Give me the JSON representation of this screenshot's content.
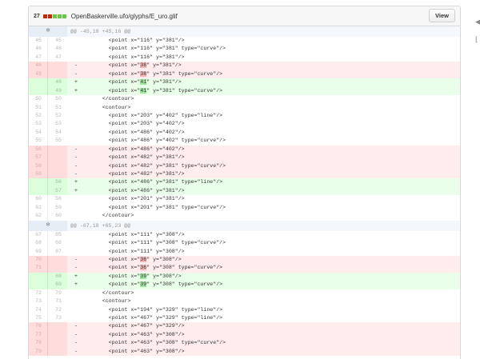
{
  "file": {
    "count": "27",
    "path": "OpenBaskerville.ufo/glyphs/E_uro.glif",
    "view_label": "View",
    "stat_colors": [
      "#bd2c00",
      "#bd2c00",
      "#6cc644",
      "#6cc644",
      "#6cc644"
    ]
  },
  "rows": [
    {
      "type": "hunk",
      "text": "@@ -45,18 +45,16 @@"
    },
    {
      "type": "ctx",
      "l": "45",
      "r": "45",
      "pre": "        <point x=\"116\" y=\"381\"/>"
    },
    {
      "type": "ctx",
      "l": "46",
      "r": "46",
      "pre": "        <point x=\"116\" y=\"381\" type=\"curve\"/>"
    },
    {
      "type": "ctx",
      "l": "47",
      "r": "47",
      "pre": "        <point x=\"116\" y=\"381\"/>"
    },
    {
      "type": "del",
      "l": "48",
      "r": "",
      "sign": "-",
      "pre": "        <point x=\"",
      "hl": "38",
      "post": "\" y=\"381\"/>"
    },
    {
      "type": "del",
      "l": "49",
      "r": "",
      "sign": "-",
      "pre": "        <point x=\"",
      "hl": "38",
      "post": "\" y=\"381\" type=\"curve\"/>"
    },
    {
      "type": "add",
      "l": "",
      "r": "48",
      "sign": "+",
      "pre": "        <point x=\"",
      "hl": "41",
      "post": "\" y=\"381\"/>"
    },
    {
      "type": "add",
      "l": "",
      "r": "49",
      "sign": "+",
      "pre": "        <point x=\"",
      "hl": "41",
      "post": "\" y=\"381\" type=\"curve\"/>"
    },
    {
      "type": "ctx",
      "l": "50",
      "r": "50",
      "pre": "      </contour>"
    },
    {
      "type": "ctx",
      "l": "51",
      "r": "51",
      "pre": "      <contour>"
    },
    {
      "type": "ctx",
      "l": "52",
      "r": "52",
      "pre": "        <point x=\"203\" y=\"402\" type=\"line\"/>"
    },
    {
      "type": "ctx",
      "l": "53",
      "r": "53",
      "pre": "        <point x=\"203\" y=\"402\"/>"
    },
    {
      "type": "ctx",
      "l": "54",
      "r": "54",
      "pre": "        <point x=\"486\" y=\"402\"/>"
    },
    {
      "type": "ctx",
      "l": "55",
      "r": "55",
      "pre": "        <point x=\"486\" y=\"402\" type=\"curve\"/>"
    },
    {
      "type": "del",
      "l": "56",
      "r": "",
      "sign": "-",
      "pre": "        <point x=\"486\" y=\"402\"/>"
    },
    {
      "type": "del",
      "l": "57",
      "r": "",
      "sign": "-",
      "pre": "        <point x=\"482\" y=\"381\"/>"
    },
    {
      "type": "del",
      "l": "58",
      "r": "",
      "sign": "-",
      "pre": "        <point x=\"482\" y=\"381\" type=\"curve\"/>"
    },
    {
      "type": "del",
      "l": "59",
      "r": "",
      "sign": "-",
      "pre": "        <point x=\"482\" y=\"381\"/>"
    },
    {
      "type": "add",
      "l": "",
      "r": "56",
      "sign": "+",
      "pre": "        <point x=\"486\" y=\"381\" type=\"line\"/>"
    },
    {
      "type": "add",
      "l": "",
      "r": "57",
      "sign": "+",
      "pre": "        <point x=\"486\" y=\"381\"/>"
    },
    {
      "type": "ctx",
      "l": "60",
      "r": "58",
      "pre": "        <point x=\"201\" y=\"381\"/>"
    },
    {
      "type": "ctx",
      "l": "61",
      "r": "59",
      "pre": "        <point x=\"201\" y=\"381\" type=\"curve\"/>"
    },
    {
      "type": "ctx",
      "l": "62",
      "r": "60",
      "pre": "      </contour>"
    },
    {
      "type": "hunk",
      "text": "@@ -67,18 +65,23 @@"
    },
    {
      "type": "ctx",
      "l": "67",
      "r": "65",
      "pre": "        <point x=\"111\" y=\"308\"/>"
    },
    {
      "type": "ctx",
      "l": "68",
      "r": "66",
      "pre": "        <point x=\"111\" y=\"308\" type=\"curve\"/>"
    },
    {
      "type": "ctx",
      "l": "69",
      "r": "67",
      "pre": "        <point x=\"111\" y=\"308\"/>"
    },
    {
      "type": "del",
      "l": "70",
      "r": "",
      "sign": "-",
      "pre": "        <point x=\"",
      "hl": "36",
      "post": "\" y=\"308\"/>"
    },
    {
      "type": "del",
      "l": "71",
      "r": "",
      "sign": "-",
      "pre": "        <point x=\"",
      "hl": "36",
      "post": "\" y=\"308\" type=\"curve\"/>"
    },
    {
      "type": "add",
      "l": "",
      "r": "68",
      "sign": "+",
      "pre": "        <point x=\"",
      "hl": "39",
      "post": "\" y=\"308\"/>"
    },
    {
      "type": "add",
      "l": "",
      "r": "69",
      "sign": "+",
      "pre": "        <point x=\"",
      "hl": "39",
      "post": "\" y=\"308\" type=\"curve\"/>"
    },
    {
      "type": "ctx",
      "l": "72",
      "r": "70",
      "pre": "      </contour>"
    },
    {
      "type": "ctx",
      "l": "73",
      "r": "71",
      "pre": "      <contour>"
    },
    {
      "type": "ctx",
      "l": "74",
      "r": "72",
      "pre": "        <point x=\"194\" y=\"329\" type=\"line\"/>"
    },
    {
      "type": "ctx",
      "l": "75",
      "r": "73",
      "pre": "        <point x=\"467\" y=\"329\" type=\"line\"/>"
    },
    {
      "type": "del",
      "l": "76",
      "r": "",
      "sign": "-",
      "pre": "        <point x=\"467\" y=\"329\"/>"
    },
    {
      "type": "del",
      "l": "77",
      "r": "",
      "sign": "-",
      "pre": "        <point x=\"463\" y=\"308\"/>"
    },
    {
      "type": "del",
      "l": "78",
      "r": "",
      "sign": "-",
      "pre": "        <point x=\"463\" y=\"308\" type=\"curve\"/>"
    },
    {
      "type": "del",
      "l": "79",
      "r": "",
      "sign": "-",
      "pre": "        <point x=\"463\" y=\"308\"/>"
    }
  ]
}
